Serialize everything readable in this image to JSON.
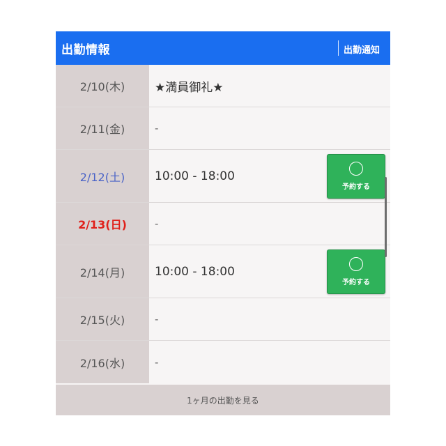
{
  "header": {
    "title": "出勤情報",
    "notify_label": "出勤通知"
  },
  "rows": [
    {
      "date": "2/10(木)",
      "value": "★満員御礼★"
    },
    {
      "date": "2/11(金)",
      "value": "-"
    },
    {
      "date": "2/12(土)",
      "value": "10:00 - 18:00",
      "button": "予約する"
    },
    {
      "date": "2/13(日)",
      "value": "-"
    },
    {
      "date": "2/14(月)",
      "value": "10:00 - 18:00",
      "button": "予約する"
    },
    {
      "date": "2/15(火)",
      "value": "-"
    },
    {
      "date": "2/16(水)",
      "value": "-"
    }
  ],
  "footer": {
    "link_label": "1ヶ月の出勤を見る"
  },
  "colors": {
    "header_bg": "#1a6ef0",
    "saturday": "#4a63c7",
    "sunday": "#e0201a",
    "reserve_button": "#2fb25a"
  },
  "icons": {
    "reserve": "circle-icon"
  }
}
